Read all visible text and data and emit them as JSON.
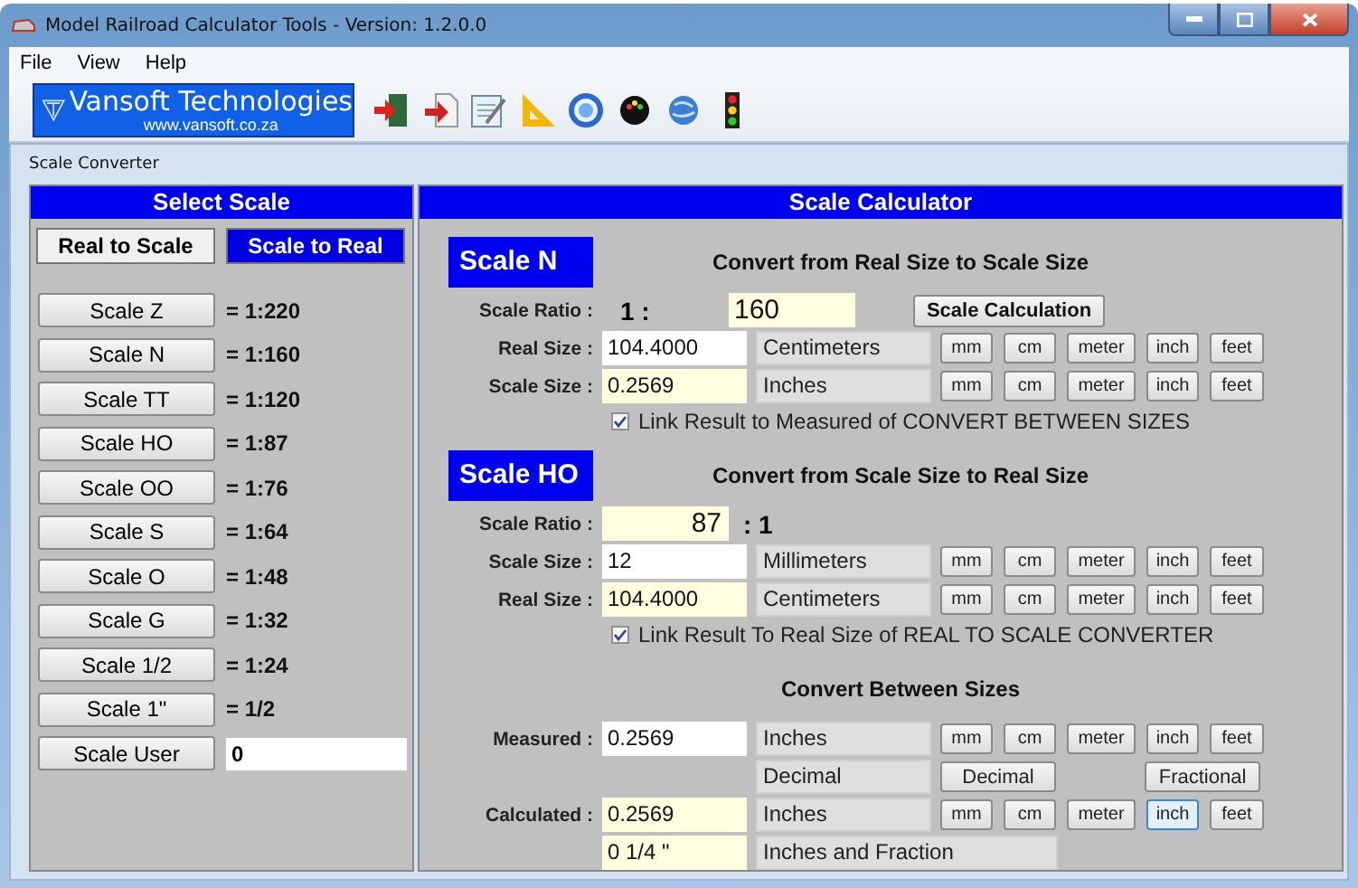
{
  "window": {
    "title": "Model Railroad Calculator Tools - Version: 1.2.0.0"
  },
  "menu": [
    "File",
    "View",
    "Help"
  ],
  "logo": {
    "name": "Vansoft Technologies",
    "url": "www.vansoft.co.za"
  },
  "form_title": "Scale Converter",
  "select_scale": {
    "title": "Select Scale",
    "modes": [
      {
        "label": "Real to Scale",
        "selected": false
      },
      {
        "label": "Scale to Real",
        "selected": true
      }
    ],
    "scales": [
      {
        "label": "Scale Z",
        "ratio": "= 1:220"
      },
      {
        "label": "Scale N",
        "ratio": "= 1:160"
      },
      {
        "label": "Scale TT",
        "ratio": "= 1:120"
      },
      {
        "label": "Scale HO",
        "ratio": "= 1:87"
      },
      {
        "label": "Scale OO",
        "ratio": "= 1:76"
      },
      {
        "label": "Scale S",
        "ratio": "= 1:64"
      },
      {
        "label": "Scale O",
        "ratio": "= 1:48"
      },
      {
        "label": "Scale G",
        "ratio": "= 1:32"
      },
      {
        "label": "Scale 1/2",
        "ratio": "= 1:24"
      },
      {
        "label": "Scale 1\"",
        "ratio": "= 1/2"
      }
    ],
    "user": {
      "label": "Scale User",
      "value": "0"
    }
  },
  "calculator": {
    "title": "Scale Calculator",
    "real_to_scale": {
      "badge": "Scale N",
      "heading": "Convert from Real Size to Scale Size",
      "ratio_label": "Scale Ratio :",
      "ratio_prefix": "1 :",
      "ratio_value": "160",
      "calc_button": "Scale Calculation",
      "rows": [
        {
          "label": "Real Size :",
          "value": "104.4000",
          "readonly": false,
          "unit": "Centimeters",
          "units": [
            {
              "label": "mm",
              "selected": false
            },
            {
              "label": "cm",
              "selected": false
            },
            {
              "label": "meter",
              "selected": false
            },
            {
              "label": "inch",
              "selected": false
            },
            {
              "label": "feet",
              "selected": false
            }
          ]
        },
        {
          "label": "Scale Size :",
          "value": "0.2569",
          "readonly": true,
          "unit": "Inches",
          "units": [
            {
              "label": "mm",
              "selected": false
            },
            {
              "label": "cm",
              "selected": false
            },
            {
              "label": "meter",
              "selected": false
            },
            {
              "label": "inch",
              "selected": false
            },
            {
              "label": "feet",
              "selected": false
            }
          ]
        }
      ],
      "link": {
        "label": "Link Result to Measured of CONVERT BETWEEN SIZES",
        "checked": true
      }
    },
    "scale_to_real": {
      "badge": "Scale HO",
      "heading": "Convert from Scale Size to Real Size",
      "ratio_label": "Scale Ratio :",
      "ratio_value": "87",
      "ratio_suffix": ": 1",
      "rows": [
        {
          "label": "Scale Size :",
          "value": "12",
          "readonly": false,
          "unit": "Millimeters",
          "units": [
            {
              "label": "mm",
              "selected": false
            },
            {
              "label": "cm",
              "selected": false
            },
            {
              "label": "meter",
              "selected": false
            },
            {
              "label": "inch",
              "selected": false
            },
            {
              "label": "feet",
              "selected": false
            }
          ]
        },
        {
          "label": "Real Size :",
          "value": "104.4000",
          "readonly": true,
          "unit": "Centimeters",
          "units": [
            {
              "label": "mm",
              "selected": false
            },
            {
              "label": "cm",
              "selected": false
            },
            {
              "label": "meter",
              "selected": false
            },
            {
              "label": "inch",
              "selected": false
            },
            {
              "label": "feet",
              "selected": false
            }
          ]
        }
      ],
      "link": {
        "label": "Link Result To Real Size of REAL TO SCALE CONVERTER",
        "checked": true
      }
    },
    "between": {
      "heading": "Convert Between Sizes",
      "rows": [
        {
          "kind": "units",
          "label": "Measured :",
          "value": "0.2569",
          "readonly": false,
          "unit": "Inches",
          "units": [
            {
              "label": "mm",
              "selected": false
            },
            {
              "label": "cm",
              "selected": false
            },
            {
              "label": "meter",
              "selected": false
            },
            {
              "label": "inch",
              "selected": false
            },
            {
              "label": "feet",
              "selected": false
            }
          ]
        },
        {
          "kind": "format",
          "unit": "Decimal",
          "buttons": [
            "Decimal",
            "Fractional"
          ]
        },
        {
          "kind": "units",
          "label": "Calculated :",
          "value": "0.2569",
          "readonly": true,
          "unit": "Inches",
          "units": [
            {
              "label": "mm",
              "selected": false
            },
            {
              "label": "cm",
              "selected": false
            },
            {
              "label": "meter",
              "selected": false
            },
            {
              "label": "inch",
              "selected": true
            },
            {
              "label": "feet",
              "selected": false
            }
          ]
        },
        {
          "kind": "plain",
          "value": "0 1/4 \"",
          "readonly": true,
          "unit": "Inches and Fraction"
        }
      ]
    }
  }
}
